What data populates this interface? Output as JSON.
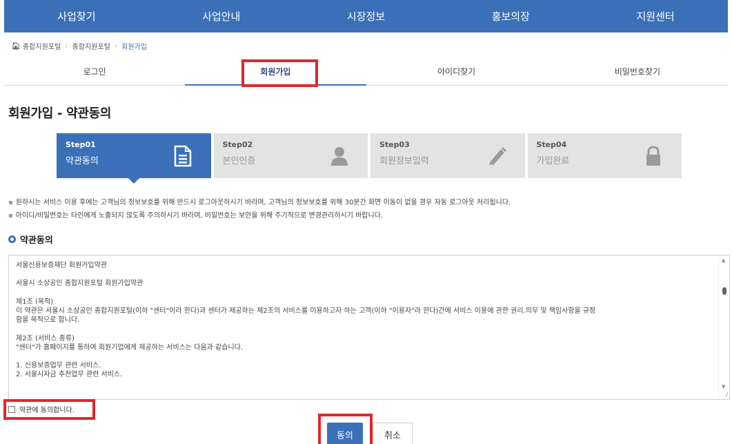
{
  "nav": {
    "items": [
      "사업찾기",
      "사업안내",
      "시장정보",
      "홍보의장",
      "지원센터"
    ]
  },
  "breadcrumb": {
    "items": [
      "종합지원포털",
      "종합지원포털"
    ],
    "current": "회원가입"
  },
  "tabs": {
    "items": [
      "로그인",
      "회원가입",
      "아이디찾기",
      "비밀번호찾기"
    ],
    "active": "회원가입"
  },
  "page_title": "회원가입 - 약관동의",
  "steps": [
    {
      "num": "Step01",
      "name": "약관동의",
      "icon": "document-icon",
      "active": true
    },
    {
      "num": "Step02",
      "name": "본인인증",
      "icon": "user-icon",
      "active": false
    },
    {
      "num": "Step03",
      "name": "회원정보입력",
      "icon": "pencil-icon",
      "active": false
    },
    {
      "num": "Step04",
      "name": "가입완료",
      "icon": "lock-icon",
      "active": false
    }
  ],
  "notes": [
    "원하시는 서비스 이용 후에는 고객님의 정보보호를 위해 반드시 로그아웃하시기 바라며, 고객님의 정보보호를 위해 30분간 화면 이동이 없을 경우 자동 로그아웃 처리됩니다.",
    "아이디/비밀번호는 타인에게 노출되지 않도록 주의하시기 바라며, 비밀번호는 보안을 위해 주기적으로 변경관리하시기 바랍니다."
  ],
  "section_title": "약관동의",
  "terms": {
    "lines": [
      "서울신용보증재단 회원가입약관",
      "",
      "서울시 소상공인 종합지원포털 회원가입약관",
      "",
      "제1조 (목적)",
      "이 약관은 서울시 소상공인 종합지원포털(이하 \"센터\"이라 한다)과 센터가 제공하는 제2조의 서비스를 이용하고자 하는 고객(이하 \"이용자\"라 한다)간에 서비스 이용에 관한 권리.의무 및 책임사항을 규정",
      "함을 목적으로 합니다.",
      "",
      "제2조 (서비스 종류)",
      "\"센터\"가 홈페이지를 통하여 회원기업에게 제공하는 서비스는 다음과 같습니다.",
      "",
      "1. 신용보증업무 관련 서비스.",
      "2. 서울시자금 추천업무 관련 서비스."
    ]
  },
  "agree": {
    "label": "약관에 동의합니다.",
    "checked": false
  },
  "buttons": {
    "agree": "동의",
    "cancel": "취소"
  },
  "colors": {
    "primary": "#3b70b8",
    "highlight": "#e2262b",
    "step_inactive": "#e3e3e3"
  }
}
